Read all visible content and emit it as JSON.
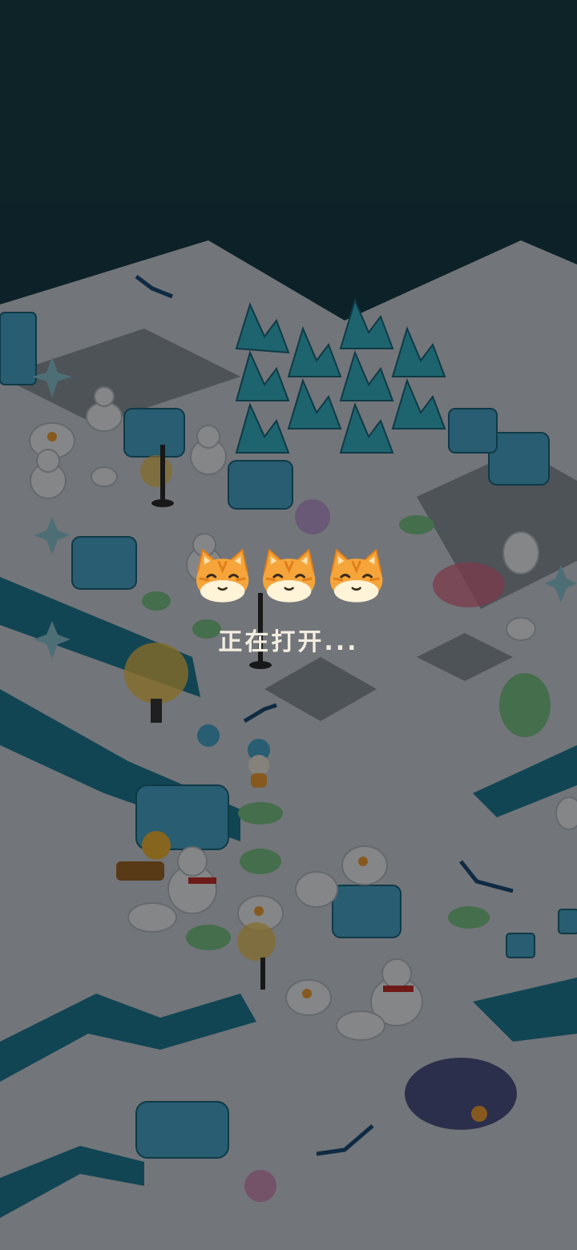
{
  "loading": {
    "text": "正在打开...",
    "indicator_icons": [
      "cat-face-icon",
      "cat-face-icon",
      "cat-face-icon"
    ]
  },
  "colors": {
    "sky": "#173f49",
    "snow_ground": "#cfd6dc",
    "dim_overlay": "rgba(0,0,0,0.45)",
    "ice_water": "#1f7f9a",
    "ice_crystal": "#36b6c8",
    "cat_orange": "#f5a53a",
    "loading_text": "#f2ede0"
  }
}
